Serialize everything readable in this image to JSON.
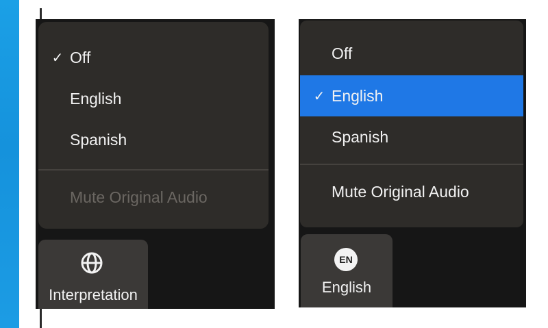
{
  "left_panel": {
    "menu_items": [
      {
        "label": "Off",
        "checked": true,
        "check": "✓"
      },
      {
        "label": "English",
        "checked": false
      },
      {
        "label": "Spanish",
        "checked": false
      }
    ],
    "mute_label": "Mute Original Audio",
    "mute_enabled": false,
    "button": {
      "icon": "globe-icon",
      "label": "Interpretation"
    }
  },
  "right_panel": {
    "menu_items": [
      {
        "label": "Off",
        "checked": false
      },
      {
        "label": "English",
        "checked": true,
        "check": "✓"
      },
      {
        "label": "Spanish",
        "checked": false
      }
    ],
    "mute_label": "Mute Original Audio",
    "mute_enabled": true,
    "button": {
      "icon": "language-badge-icon",
      "badge_text": "EN",
      "label": "English"
    }
  },
  "colors": {
    "background": "#1592dc",
    "menu_bg": "#2e2c29",
    "selected": "#1f78e6",
    "disabled_text": "#6b6762"
  }
}
